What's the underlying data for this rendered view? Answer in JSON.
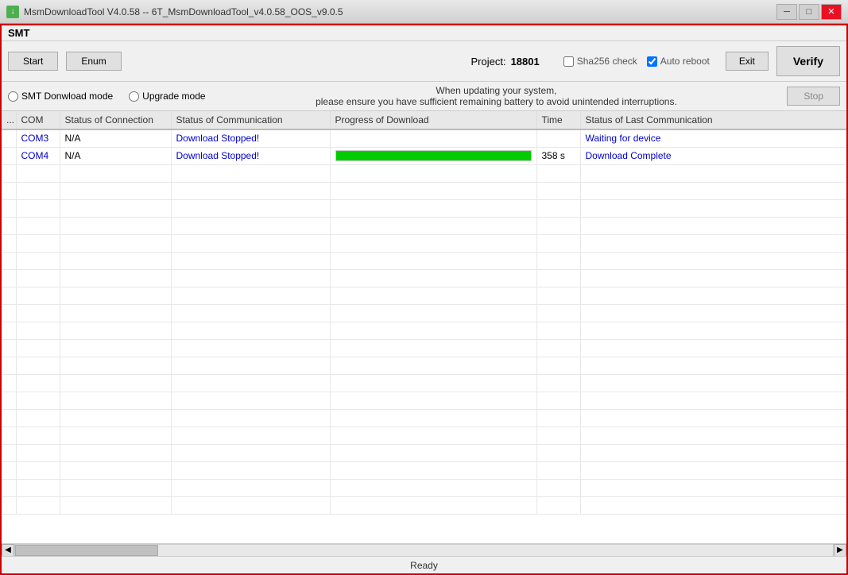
{
  "titleBar": {
    "icon": "↓",
    "title": "MsmDownloadTool V4.0.58 -- 6T_MsmDownloadTool_v4.0.58_OOS_v9.0.5",
    "minimizeLabel": "─",
    "restoreLabel": "□",
    "closeLabel": "✕"
  },
  "smt": {
    "label": "SMT"
  },
  "toolbar": {
    "startLabel": "Start",
    "enumLabel": "Enum",
    "projectLabel": "Project:",
    "projectValue": "18801",
    "sha256Label": "Sha256 check",
    "autoRebootLabel": "Auto reboot",
    "exitLabel": "Exit",
    "verifyLabel": "Verify",
    "stopLabel": "Stop"
  },
  "infoBar": {
    "line1": "When updating your system,",
    "line2": "please ensure you have sufficient remaining battery to avoid unintended interruptions.",
    "mode1": "SMT Donwload mode",
    "mode2": "Upgrade mode",
    "statusLastComm": "Status of Last Communication"
  },
  "table": {
    "headers": {
      "num": "...",
      "com": "COM",
      "statusConn": "Status of Connection",
      "statusComm": "Status of Communication",
      "progress": "Progress of Download",
      "time": "Time",
      "statusLast": "Status of Last Communication"
    },
    "rows": [
      {
        "num": "",
        "com": "COM3",
        "statusConn": "N/A",
        "statusComm": "Download Stopped!",
        "progressPercent": 0,
        "time": "",
        "statusLast": "Waiting for device"
      },
      {
        "num": "",
        "com": "COM4",
        "statusConn": "N/A",
        "statusComm": "Download Stopped!",
        "progressPercent": 100,
        "time": "358 s",
        "statusLast": "Download Complete"
      }
    ]
  },
  "statusBar": {
    "text": "Ready"
  },
  "colors": {
    "progressFill": "#00cc00",
    "accent": "#cc0000",
    "linkColor": "#0000cc"
  }
}
